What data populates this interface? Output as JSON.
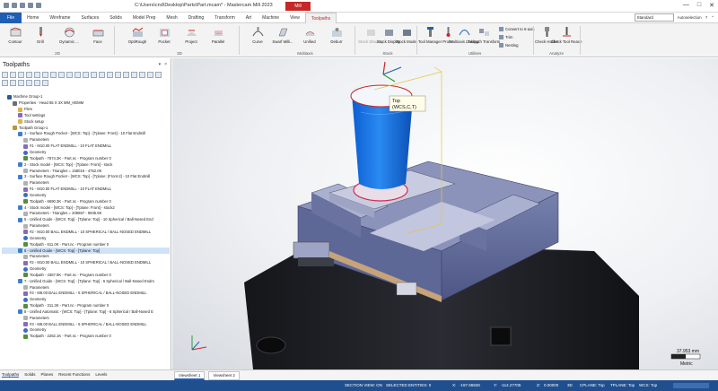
{
  "titlebar": {
    "title": "C:\\Users\\cnd\\Desktop\\Parts\\Part.mcam* - Mastercam Mill 2023",
    "context_tab": "Mill",
    "controls": [
      "—",
      "□",
      "✕"
    ]
  },
  "tabs": [
    "File",
    "Home",
    "Wireframe",
    "Surfaces",
    "Solids",
    "Model Prep",
    "Mesh",
    "Drafting",
    "Transform",
    "Art",
    "Machine",
    "View",
    "Toolpaths"
  ],
  "active_tab": "Toolpaths",
  "tabrow_right": {
    "select": "Standard",
    "check_label": "Autoselection"
  },
  "ribbon": {
    "groups": [
      "2D",
      "3D",
      "Multiaxis",
      "Stock",
      "Utilities",
      "Analyze"
    ],
    "buttons": {
      "contour": "Contour",
      "drill": "Drill",
      "dynamic": "Dynamic ...",
      "face": "Face",
      "optirough": "OptiRough",
      "pocket": "Pocket",
      "project": "Project",
      "parallel": "Parallel",
      "curve": "Curve",
      "swarf": "Swarf Milli...",
      "unified": "Unified",
      "deburr": "Deburr",
      "stock_shading": "Stock Shading",
      "stock_display": "Stock Display",
      "stock_model": "Stock Model",
      "tool_manager": "Tool Manager",
      "probe": "Probe",
      "multiaxis_linking": "Multiaxis Linking",
      "toolpath_transform": "Toolpath Transform",
      "check_holder": "Check Holder",
      "check_tool_reach": "Check Tool Reach"
    },
    "small": {
      "convert": "Convert to 5-axis",
      "trim": "Trim",
      "nesting": "Nesting"
    }
  },
  "leftpanel": {
    "title": "Toolpaths",
    "winctl": [
      "▾",
      "×"
    ]
  },
  "tree": [
    {
      "indent": 1,
      "icon": "mach",
      "text": "Machine Group-1"
    },
    {
      "indent": 2,
      "icon": "prop",
      "text": "Properties - Head 65 X 3X MM_HEMM"
    },
    {
      "indent": 3,
      "icon": "file",
      "text": "Files"
    },
    {
      "indent": 3,
      "icon": "tool",
      "text": "Tool settings"
    },
    {
      "indent": 3,
      "icon": "file",
      "text": "Stock setup"
    },
    {
      "indent": 2,
      "icon": "grp",
      "text": "Toolpath Group-1"
    },
    {
      "indent": 3,
      "icon": "op",
      "text": "1 - Surface Rough Pocket - [WCS: Top] - [Tplane: Front] - 10 Flat Endmill"
    },
    {
      "indent": 4,
      "icon": "par",
      "text": "Parameters"
    },
    {
      "indent": 4,
      "icon": "tool",
      "text": "#1 - M10.00 FLAT ENDMILL - 10 FLAT ENDMILL"
    },
    {
      "indent": 4,
      "icon": "geo",
      "text": "Geometry"
    },
    {
      "indent": 4,
      "icon": "tp",
      "text": "Toolpath - 7674.3K - Part.nc - Program number 0"
    },
    {
      "indent": 3,
      "icon": "op",
      "text": "2 - Stock model - [WCS: Top] - [Tplane: Front] - stock"
    },
    {
      "indent": 4,
      "icon": "par",
      "text": "Parameters - Triangles = 158016 - 4752.0K"
    },
    {
      "indent": 3,
      "icon": "op",
      "text": "3 - Surface Rough Pocket - [WCS: Top] - [Tplane: (Front-2] - 10 Flat Endmill"
    },
    {
      "indent": 4,
      "icon": "par",
      "text": "Parameters"
    },
    {
      "indent": 4,
      "icon": "tool",
      "text": "#1 - M10.00 FLAT ENDMILL - 10 FLAT ENDMILL"
    },
    {
      "indent": 4,
      "icon": "geo",
      "text": "Geometry"
    },
    {
      "indent": 4,
      "icon": "tp",
      "text": "Toolpath - 6690.3K - Part.nc - Program number 0"
    },
    {
      "indent": 3,
      "icon": "op",
      "text": "4 - Stock model - [WCS: Top] - [Tplane: Front] - stock2"
    },
    {
      "indent": 4,
      "icon": "par",
      "text": "Parameters - Triangles = 209667 - 9935.8K"
    },
    {
      "indent": 3,
      "icon": "op",
      "text": "5 - Unified Guide - [WCS: Top] - [Tplane: Top] - 10 Spherical / Ball-Nosed End"
    },
    {
      "indent": 4,
      "icon": "par",
      "text": "Parameters"
    },
    {
      "indent": 4,
      "icon": "tool",
      "text": "#2 - M10.00 BALL ENDMILL - 10 SPHERICAL / BALL-NOSED ENDMILL"
    },
    {
      "indent": 4,
      "icon": "geo",
      "text": "Geometry"
    },
    {
      "indent": 4,
      "icon": "tp",
      "text": "Toolpath - 611.0K - Part.nc - Program number 0"
    },
    {
      "indent": 3,
      "icon": "op",
      "text": "6 - Unified Guide - [WCS: Top] - [Tplane: Top]",
      "selected": true
    },
    {
      "indent": 4,
      "icon": "par",
      "text": "Parameters"
    },
    {
      "indent": 4,
      "icon": "tool",
      "text": "#2 - M10.00 BALL ENDMILL - 10 SPHERICAL / BALL-NOSED ENDMILL"
    },
    {
      "indent": 4,
      "icon": "geo",
      "text": "Geometry"
    },
    {
      "indent": 4,
      "icon": "tp",
      "text": "Toolpath - 4367.9K - Part.nc - Program number 0"
    },
    {
      "indent": 3,
      "icon": "op",
      "text": "7 - Unified Guide - [WCS: Top] - [Tplane: Top] - 6 Spherical / Ball-Nosed Endm"
    },
    {
      "indent": 4,
      "icon": "par",
      "text": "Parameters"
    },
    {
      "indent": 4,
      "icon": "tool",
      "text": "#3 - M6.00 BALL ENDMILL - 6 SPHERICAL / BALL-NOSED ENDMILL"
    },
    {
      "indent": 4,
      "icon": "geo",
      "text": "Geometry"
    },
    {
      "indent": 4,
      "icon": "tp",
      "text": "Toolpath - 311.3K - Part.nc - Program number 0"
    },
    {
      "indent": 3,
      "icon": "op",
      "text": "8 - Unified Automatic - [WCS: Top] - [Tplane: Top] - 6 Spherical / Ball-Nosed E"
    },
    {
      "indent": 4,
      "icon": "par",
      "text": "Parameters"
    },
    {
      "indent": 4,
      "icon": "tool",
      "text": "#3 - M6.00 BALL ENDMILL - 6 SPHERICAL / BALL-NOSED ENDMILL"
    },
    {
      "indent": 4,
      "icon": "geo",
      "text": "Geometry"
    },
    {
      "indent": 4,
      "icon": "tp",
      "text": "Toolpath - 2262.1K - Part.nc - Program number 0"
    }
  ],
  "panel_tabs": [
    "Toolpaths",
    "Solids",
    "Planes",
    "Recent Functions",
    "Levels"
  ],
  "view_tabs": [
    "Viewsheet 1",
    "Viewsheet 2"
  ],
  "viewport": {
    "plane_label_1": "Top",
    "plane_label_2": "(WCS,C,T)",
    "scale_value": "37.953 mm",
    "scale_unit": "Metric"
  },
  "status": {
    "section": "SECTION VIEW: ON",
    "selected": "SELECTED ENTITIES: 0",
    "x_label": "X:",
    "x_val": "-197.96928",
    "y_label": "Y:",
    "y_val": "-114.27705",
    "z_label": "Z:",
    "z_val": "0.00000",
    "mode": "3D",
    "cplane": "CPLANE: Top",
    "tplane": "TPLANE: Top",
    "wcs": "WCS: Top"
  },
  "colors": {
    "accent": "#1e5fb4",
    "context": "#c62828",
    "status_bg": "#1f4f8f",
    "tool_blue": "#1f78e6",
    "vise": "#5e6897"
  }
}
